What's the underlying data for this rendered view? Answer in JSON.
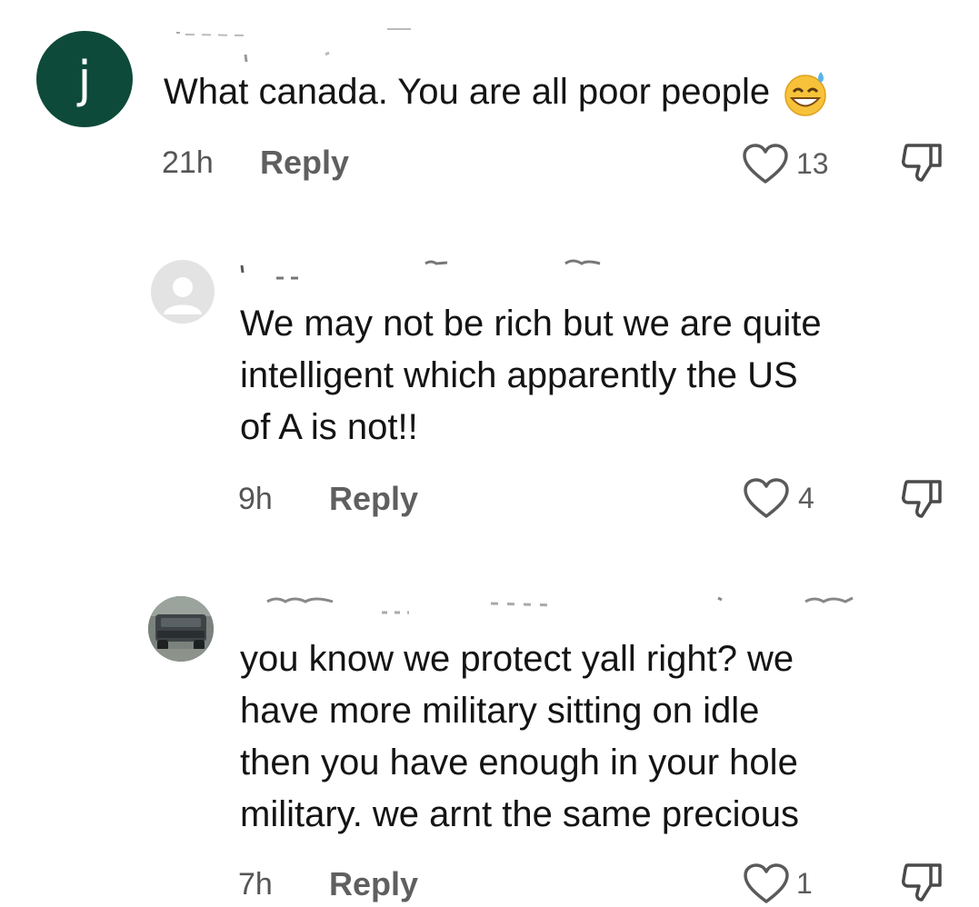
{
  "comments": [
    {
      "avatar_letter": "j",
      "username": "",
      "text_lines": [
        "What canada. You are all poor people"
      ],
      "emoji": "grinning-sweat-emoji",
      "time": "21h",
      "reply_label": "Reply",
      "likes": "13"
    },
    {
      "username": "",
      "text_lines": [
        "We may not be rich but we are quite",
        "intelligent which apparently the US",
        "of A is not!!"
      ],
      "time": "9h",
      "reply_label": "Reply",
      "likes": "4"
    },
    {
      "username": "",
      "text_lines": [
        "you know we protect yall right? we",
        "have more military sitting on idle",
        "then you have enough in your hole",
        "military. we arnt the same precious"
      ],
      "time": "7h",
      "reply_label": "Reply",
      "likes": "1"
    }
  ],
  "colors": {
    "avatar_main": "#0e4a39",
    "text": "#141414",
    "meta": "#5f5f5f"
  }
}
